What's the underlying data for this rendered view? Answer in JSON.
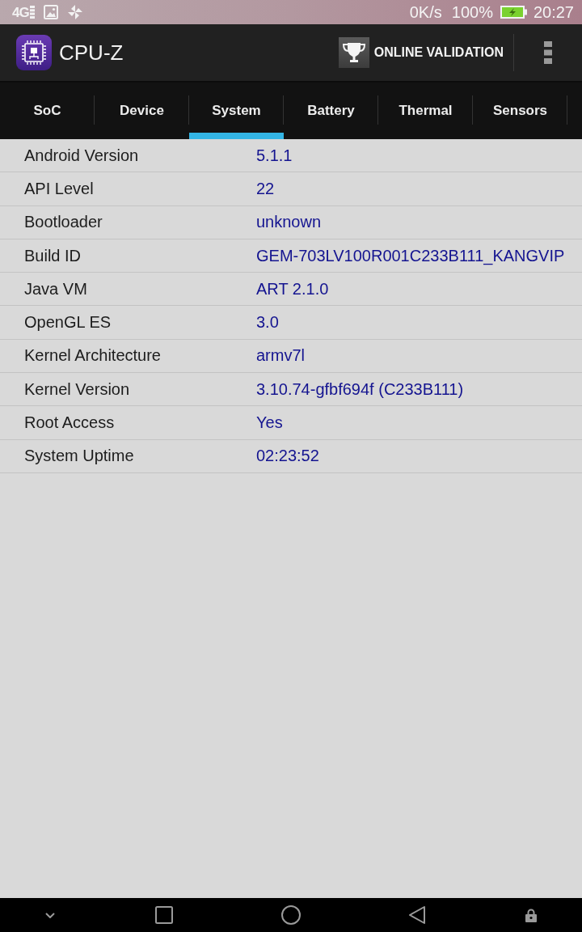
{
  "status_bar": {
    "network": "4G",
    "speed": "0K/s",
    "battery": "100%",
    "charging": true,
    "time": "20:27"
  },
  "app_bar": {
    "title": "CPU-Z",
    "validation_button": "ONLINE VALIDATION"
  },
  "tabs": [
    {
      "label": "SoC",
      "selected": false
    },
    {
      "label": "Device",
      "selected": false
    },
    {
      "label": "System",
      "selected": true
    },
    {
      "label": "Battery",
      "selected": false
    },
    {
      "label": "Thermal",
      "selected": false
    },
    {
      "label": "Sensors",
      "selected": false
    }
  ],
  "rows": [
    {
      "label": "Android Version",
      "value": "5.1.1"
    },
    {
      "label": "API Level",
      "value": "22"
    },
    {
      "label": "Bootloader",
      "value": "unknown"
    },
    {
      "label": "Build ID",
      "value": "GEM-703LV100R001C233B111_KANGVIP"
    },
    {
      "label": "Java VM",
      "value": "ART 2.1.0"
    },
    {
      "label": "OpenGL ES",
      "value": "3.0"
    },
    {
      "label": "Kernel Architecture",
      "value": "armv7l"
    },
    {
      "label": "Kernel Version",
      "value": "3.10.74-gfbf694f (C233B111)"
    },
    {
      "label": "Root Access",
      "value": "Yes"
    },
    {
      "label": "System Uptime",
      "value": "02:23:52"
    }
  ]
}
